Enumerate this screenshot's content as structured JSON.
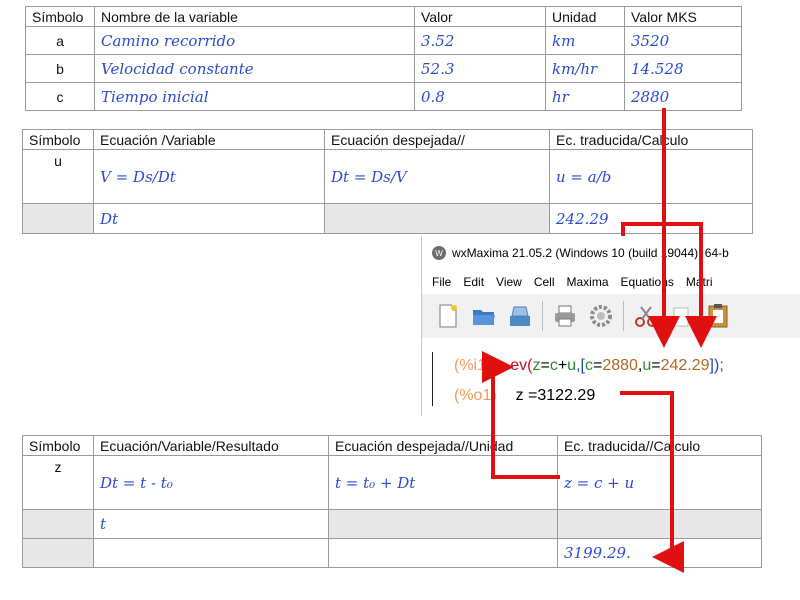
{
  "table1": {
    "headers": [
      "Símbolo",
      "Nombre de la variable",
      "Valor",
      "Unidad",
      "Valor MKS"
    ],
    "rows": [
      {
        "symbol": "a",
        "name": "Camino recorrido",
        "value": "3.52",
        "unit": "km",
        "mks": "3520"
      },
      {
        "symbol": "b",
        "name": "Velocidad constante",
        "value": "52.3",
        "unit": "km/hr",
        "mks": "14.528"
      },
      {
        "symbol": "c",
        "name": "Tiempo inicial",
        "value": "0.8",
        "unit": "hr",
        "mks": "2880"
      }
    ]
  },
  "table2": {
    "headers": [
      "Símbolo",
      "Ecuación /Variable",
      "Ecuación despejada//",
      "Ec. traducida/Calculo"
    ],
    "row1": {
      "symbol": "u",
      "equation": "V = Ds/Dt",
      "solved": "Dt = Ds/V",
      "translated": "u = a/b"
    },
    "row2": {
      "symbol": "",
      "equation": "Dt",
      "solved": "",
      "translated": "242.29"
    }
  },
  "wxmaxima": {
    "title": "wxMaxima 21.05.2 (Windows 10 (build 19044), 64-b",
    "menu": [
      "File",
      "Edit",
      "View",
      "Cell",
      "Maxima",
      "Equations",
      "Matri"
    ],
    "toolbar_icons": [
      "new-file-icon",
      "open-folder-icon",
      "save-icon",
      "print-icon",
      "settings-icon",
      "cut-icon",
      "copy-icon",
      "paste-icon"
    ],
    "input_label": "(%i1)",
    "input_fn": "ev(",
    "input_z": "z",
    "input_eq1": "=",
    "input_c": "c",
    "input_plus": "+",
    "input_u": "u",
    "input_comma1": ",[",
    "input_c2": "c",
    "input_eq2": "=",
    "input_num1": "2880",
    "input_comma2": ",",
    "input_u2": "u",
    "input_eq3": "=",
    "input_num2": "242.29",
    "input_close": "]);",
    "output_label": "(%o1)",
    "output_text": "z =3122.29"
  },
  "table3": {
    "headers": [
      "Símbolo",
      "Ecuación/Variable/Resultado",
      "Ecuación despejada//Unidad",
      "Ec. traducida//Calculo"
    ],
    "row1": {
      "symbol": "z",
      "equation": "Dt = t - t₀",
      "solved": "t = t₀ + Dt",
      "translated": "z = c + u"
    },
    "row2": {
      "symbol": "",
      "equation": "t",
      "solved": "",
      "translated": ""
    },
    "row3": {
      "symbol": "",
      "equation": "",
      "solved": "",
      "translated": "3199.29."
    }
  },
  "colors": {
    "handwriting": "#2a4bd0",
    "arrow": "#e01010",
    "shade": "#e8e8e8"
  }
}
